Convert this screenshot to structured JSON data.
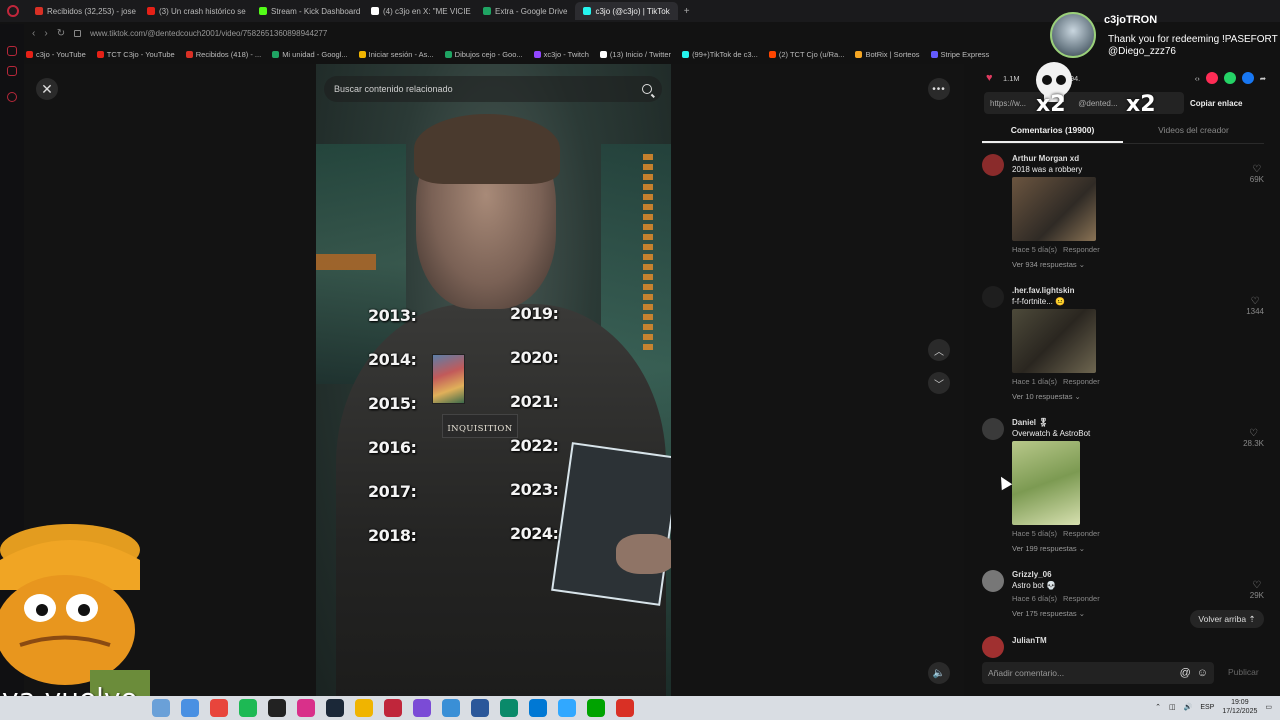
{
  "browser": {
    "tabs": [
      {
        "label": "Recibidos (32,253) - jose",
        "color": "#d93025",
        "active": false
      },
      {
        "label": "(3) Un crash histórico se",
        "color": "#e62117",
        "active": false
      },
      {
        "label": "Stream - Kick Dashboard",
        "color": "#53fc18",
        "active": false
      },
      {
        "label": "(4) c3jo en X: \"ME VICIE",
        "color": "#ffffff",
        "active": false
      },
      {
        "label": "Extra - Google Drive",
        "color": "#1fa463",
        "active": false
      },
      {
        "label": "c3jo (@c3jo) | TikTok",
        "color": "#25f4ee",
        "active": true
      }
    ],
    "new_tab": "+",
    "url": "www.tiktok.com/@dentedcouch2001/video/7582651360898944277",
    "bookmarks": [
      {
        "label": "c3jo - YouTube",
        "color": "#e62117"
      },
      {
        "label": "TCT C3jo - YouTube",
        "color": "#e62117"
      },
      {
        "label": "Recibidos (418) - ...",
        "color": "#d93025"
      },
      {
        "label": "Mi unidad - Googl...",
        "color": "#1fa463"
      },
      {
        "label": "Iniciar sesión - As...",
        "color": "#f0b400"
      },
      {
        "label": "Dibujos cejo - Goo...",
        "color": "#1fa463"
      },
      {
        "label": "xc3jo - Twitch",
        "color": "#9146ff"
      },
      {
        "label": "(13) Inicio / Twitter",
        "color": "#ffffff"
      },
      {
        "label": "(99+)TikTok de c3...",
        "color": "#25f4ee"
      },
      {
        "label": "(2) TCT Cjo (u/Ra...",
        "color": "#ff4500"
      },
      {
        "label": "BotRix | Sorteos",
        "color": "#f5a623"
      },
      {
        "label": "Stripe Express",
        "color": "#635bff"
      }
    ]
  },
  "video": {
    "search_placeholder": "Buscar contenido relacionado",
    "years_left": [
      "2013:",
      "2014:",
      "2015:",
      "2016:",
      "2017:",
      "2018:"
    ],
    "years_right": [
      "2019:",
      "2020:",
      "2021:",
      "2022:",
      "2023:",
      "2024:"
    ],
    "inquisition_label": "INQUISITION"
  },
  "panel": {
    "likes": "1.1M",
    "saves": "94.",
    "link": "https://w...",
    "link_handle": "@dented...",
    "copy_label": "Copiar enlace",
    "tab_comments": "Comentarios (19900)",
    "tab_creator": "Videos del creador",
    "reply_label": "Responder",
    "comments": [
      {
        "user": "Arthur Morgan xd",
        "text": "2018 was a robbery",
        "time": "Hace 5 día(s)",
        "replies": "Ver 934 respuestas",
        "likes": "69K"
      },
      {
        "user": ".her.fav.lightskin",
        "text": "f-f-fortnite... 😐",
        "time": "Hace 1 día(s)",
        "replies": "Ver 10 respuestas",
        "likes": "1344"
      },
      {
        "user": "Daniel 🎖",
        "text": "Overwatch & AstroBot",
        "time": "Hace 5 día(s)",
        "replies": "Ver 199 respuestas",
        "likes": "28.3K"
      },
      {
        "user": "Grizzly_06",
        "text": "Astro bot 💀",
        "time": "Hace 6 día(s)",
        "replies": "Ver 175 respuestas",
        "likes": "29K"
      },
      {
        "user": "JulianTM",
        "text": "",
        "time": "",
        "replies": "",
        "likes": ""
      }
    ],
    "back_to_top": "Volver arriba ⇡",
    "comment_placeholder": "Añadir comentario...",
    "publish": "Publicar"
  },
  "overlay": {
    "notif_name": "c3joTRON",
    "notif_message": "Thank you for redeeming !PASEFORT @Diego_zzz76",
    "multiplier_a": "x2",
    "multiplier_b": "x2",
    "caption": "ya vuelvo"
  },
  "taskbar": {
    "lang": "ESP",
    "time": "19:09",
    "date": "17/12/2025"
  }
}
